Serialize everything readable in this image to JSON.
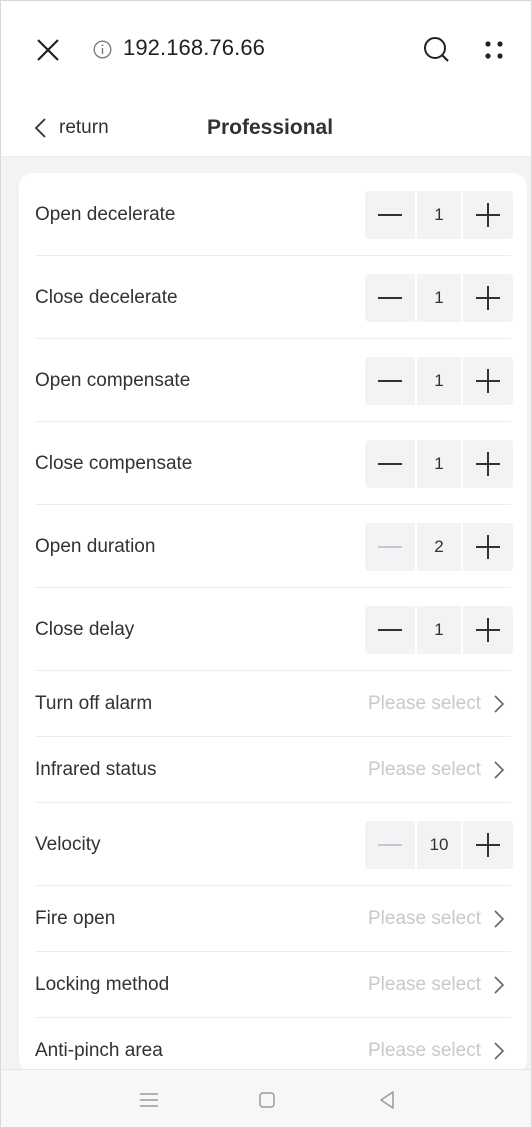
{
  "browser": {
    "url": "192.168.76.66"
  },
  "header": {
    "back_label": "return",
    "title": "Professional"
  },
  "rows": [
    {
      "label": "Open decelerate",
      "type": "stepper",
      "value": "1",
      "minus_disabled": false
    },
    {
      "label": "Close decelerate",
      "type": "stepper",
      "value": "1",
      "minus_disabled": false
    },
    {
      "label": "Open compensate",
      "type": "stepper",
      "value": "1",
      "minus_disabled": false
    },
    {
      "label": "Close compensate",
      "type": "stepper",
      "value": "1",
      "minus_disabled": false
    },
    {
      "label": "Open duration",
      "type": "stepper",
      "value": "2",
      "minus_disabled": true
    },
    {
      "label": "Close delay",
      "type": "stepper",
      "value": "1",
      "minus_disabled": false
    },
    {
      "label": "Turn off alarm",
      "type": "select",
      "placeholder": "Please select"
    },
    {
      "label": "Infrared status",
      "type": "select",
      "placeholder": "Please select"
    },
    {
      "label": "Velocity",
      "type": "stepper",
      "value": "10",
      "minus_disabled": true
    },
    {
      "label": "Fire open",
      "type": "select",
      "placeholder": "Please select"
    },
    {
      "label": "Locking method",
      "type": "select",
      "placeholder": "Please select"
    },
    {
      "label": "Anti-pinch area",
      "type": "select",
      "placeholder": "Please select"
    }
  ],
  "colors": {
    "background": "#f2f3f5",
    "text": "#323233",
    "placeholder": "#c8c9cc"
  }
}
